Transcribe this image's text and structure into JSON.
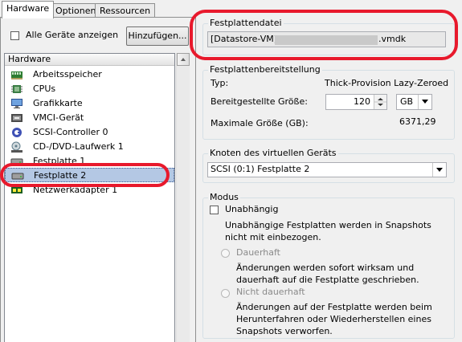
{
  "tabs": [
    "Hardware",
    "Optionen",
    "Ressourcen"
  ],
  "left": {
    "show_all_label": "Alle Geräte anzeigen",
    "add_button": "Hinzufügen...",
    "list_header": "Hardware",
    "items": [
      {
        "label": "Arbeitsspeicher",
        "icon": "memory-icon"
      },
      {
        "label": "CPUs",
        "icon": "cpu-icon"
      },
      {
        "label": "Grafikkarte",
        "icon": "monitor-icon"
      },
      {
        "label": "VMCI-Gerät",
        "icon": "vmci-icon"
      },
      {
        "label": "SCSI-Controller 0",
        "icon": "scsi-controller-icon"
      },
      {
        "label": "CD-/DVD-Laufwerk 1",
        "icon": "cd-dvd-icon"
      },
      {
        "label": "Festplatte 1",
        "icon": "hard-disk-icon"
      },
      {
        "label": "Festplatte 2",
        "icon": "hard-disk-icon",
        "selected": true
      },
      {
        "label": "Netzwerkadapter 1",
        "icon": "network-adapter-icon"
      }
    ]
  },
  "disk_file": {
    "title": "Festplattendatei",
    "value_prefix": "[Datastore-VM]",
    "value_suffix": ".vmdk"
  },
  "provisioning": {
    "title": "Festplattenbereitstellung",
    "type_label": "Typ:",
    "type_value": "Thick-Provision Lazy-Zeroed",
    "size_label": "Bereitgestellte Größe:",
    "size_value": "120",
    "size_unit": "GB",
    "max_label": "Maximale Größe (GB):",
    "max_value": "6371,29"
  },
  "node": {
    "title": "Knoten des virtuellen Geräts",
    "value": "SCSI (0:1) Festplatte 2"
  },
  "mode": {
    "title": "Modus",
    "independent_label": "Unabhängig",
    "independent_desc": "Unabhängige Festplatten werden in Snapshots nicht mit einbezogen.",
    "persistent_label": "Dauerhaft",
    "persistent_desc": "Änderungen werden sofort wirksam und dauerhaft auf die Festplatte geschrieben.",
    "nonpersistent_label": "Nicht dauerhaft",
    "nonpersistent_desc": "Änderungen auf der Festplatte werden beim Herunterfahren oder Wiederherstellen eines Snapshots verworfen."
  },
  "colors": {
    "highlight_oval": "#e8192c",
    "selection": "#b4c8e4"
  }
}
